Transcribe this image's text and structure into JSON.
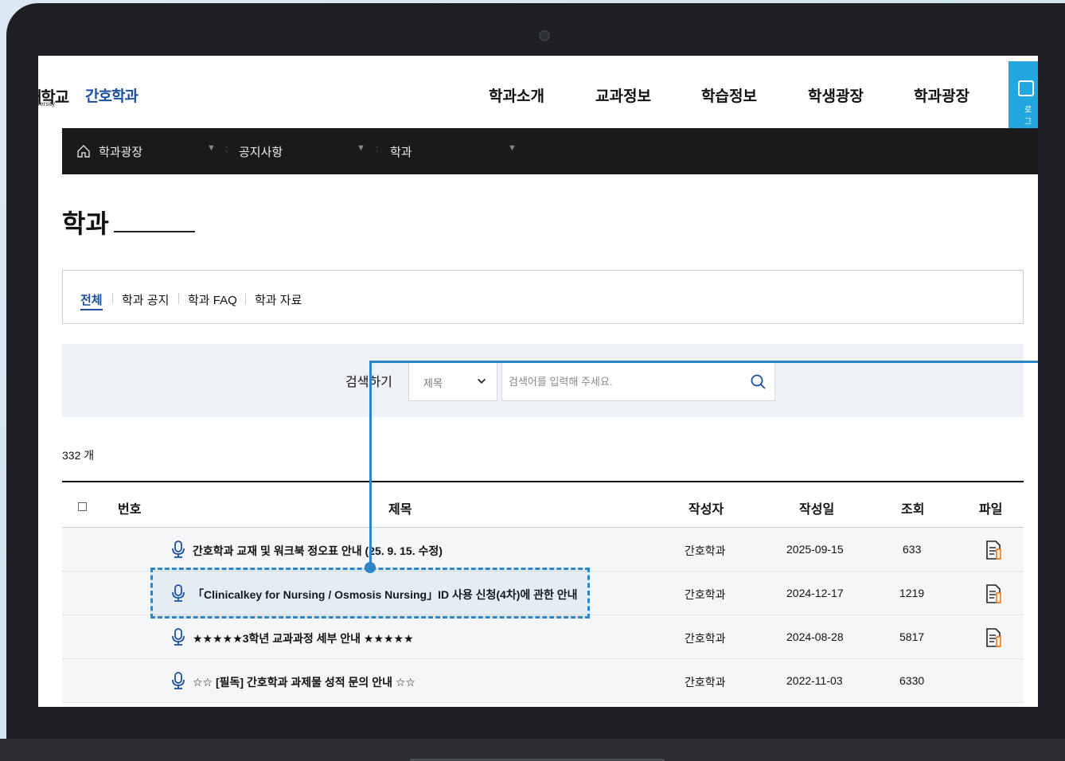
{
  "header": {
    "univ_logo": "대학교",
    "univ_sub": "University",
    "dept_logo": "간호학과",
    "nav": [
      "학과소개",
      "교과정보",
      "학습정보",
      "학생광장",
      "학과광장"
    ],
    "login": "로그인"
  },
  "breadcrumb": {
    "items": [
      "학과광장",
      "공지사항",
      "학과"
    ]
  },
  "page": {
    "title": "학과"
  },
  "tabs": [
    "전체",
    "학과 공지",
    "학과 FAQ",
    "학과 자료"
  ],
  "search": {
    "label": "검색하기",
    "select_value": "제목",
    "placeholder": "검색어를 입력해 주세요."
  },
  "count": "332 개",
  "table": {
    "headers": [
      "번호",
      "제목",
      "작성자",
      "작성일",
      "조회",
      "파일"
    ],
    "rows": [
      {
        "title": "간호학과 교재 및 워크북 정오표 안내 (25. 9. 15. 수정)",
        "author": "간호학과",
        "date": "2025-09-15",
        "views": "633",
        "file": true
      },
      {
        "title": "「Clinicalkey for Nursing / Osmosis Nursing」ID 사용 신청(4차)에 관한 안내",
        "author": "간호학과",
        "date": "2024-12-17",
        "views": "1219",
        "file": true
      },
      {
        "title": "★★★★★3학년 교과과정 세부 안내 ★★★★★",
        "author": "간호학과",
        "date": "2024-08-28",
        "views": "5817",
        "file": true
      },
      {
        "title": "☆☆ [필독] 간호학과 과제물 성적 문의 안내 ☆☆",
        "author": "간호학과",
        "date": "2022-11-03",
        "views": "6330",
        "file": false
      }
    ]
  },
  "colors": {
    "brand_blue": "#1c4f9e",
    "login_blue": "#22a6e0",
    "annotation": "#2e86c8"
  }
}
